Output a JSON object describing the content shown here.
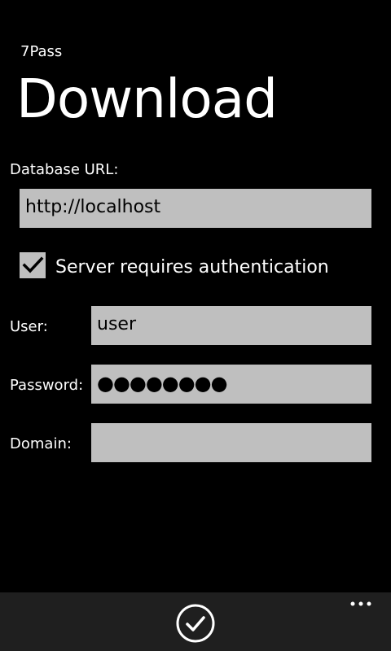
{
  "header": {
    "app_name": "7Pass",
    "page_title": "Download"
  },
  "form": {
    "database_url_label": "Database URL:",
    "database_url_value": "http://localhost",
    "auth_checkbox": {
      "label": "Server requires authentication",
      "checked": true
    },
    "user_label": "User:",
    "user_value": "user",
    "password_label": "Password:",
    "password_value_masked": "●●●●●●●●",
    "domain_label": "Domain:",
    "domain_value": ""
  },
  "app_bar": {
    "confirm_icon": "check-circle-icon",
    "more_icon": "ellipsis-icon"
  },
  "colors": {
    "background": "#000000",
    "field_background": "#bfbfbf",
    "app_bar_background": "#1f1f1f",
    "text": "#ffffff"
  }
}
